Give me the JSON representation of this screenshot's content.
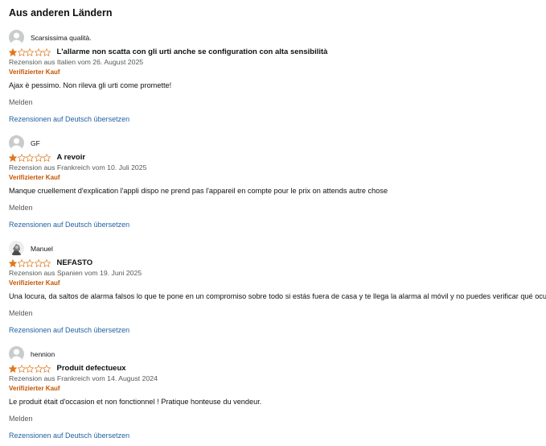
{
  "section": {
    "heading": "Aus anderen Ländern"
  },
  "colors": {
    "star_filled": "#de7921",
    "star_empty": "#de7921",
    "verified": "#c45500",
    "link": "#2162a1",
    "meta": "#565959"
  },
  "reviews": [
    {
      "profile_name": "Scarsissima qualità.",
      "avatar_icon": "default-avatar-icon",
      "rating": 1,
      "rating_max": 5,
      "title": "L'allarme non scatta con gli urti anche se configuration con alta sensibilità",
      "meta": "Rezension aus Italien vom 26. August 2025",
      "verified": "Verifizierter Kauf",
      "body": "Ajax è pessimo. Non rileva gli urti come promette!",
      "report": "Melden",
      "translate": "Rezensionen auf Deutsch übersetzen"
    },
    {
      "profile_name": "GF",
      "avatar_icon": "default-avatar-icon",
      "rating": 1,
      "rating_max": 5,
      "title": "A revoir",
      "meta": "Rezension aus Frankreich vom 10. Juli 2025",
      "verified": "Verifizierter Kauf",
      "body": "Manque cruellement d'explication l'appli dispo ne prend pas l'appareil en compte pour le prix on attends autre chose",
      "report": "Melden",
      "translate": "Rezensionen auf Deutsch übersetzen"
    },
    {
      "profile_name": "Manuel",
      "avatar_icon": "photo-avatar-icon",
      "rating": 1,
      "rating_max": 5,
      "title": "NEFASTO",
      "meta": "Rezension aus Spanien vom 19. Juni 2025",
      "verified": "Verifizierter Kauf",
      "body": "Una locura, da saltos de alarma falsos lo que te pone en un compromiso sobre todo si estás fuera de casa y te llega la alarma al móvil y no puedes verificar qué ocurre",
      "report": "Melden",
      "translate": "Rezensionen auf Deutsch übersetzen"
    },
    {
      "profile_name": "hennion",
      "avatar_icon": "default-avatar-icon",
      "rating": 1,
      "rating_max": 5,
      "title": "Produit defectueux",
      "meta": "Rezension aus Frankreich vom 14. August 2024",
      "verified": "Verifizierter Kauf",
      "body": "Le produit était d'occasion et non fonctionnel ! Pratique honteuse du vendeur.",
      "report": "Melden",
      "translate": "Rezensionen auf Deutsch übersetzen"
    }
  ]
}
